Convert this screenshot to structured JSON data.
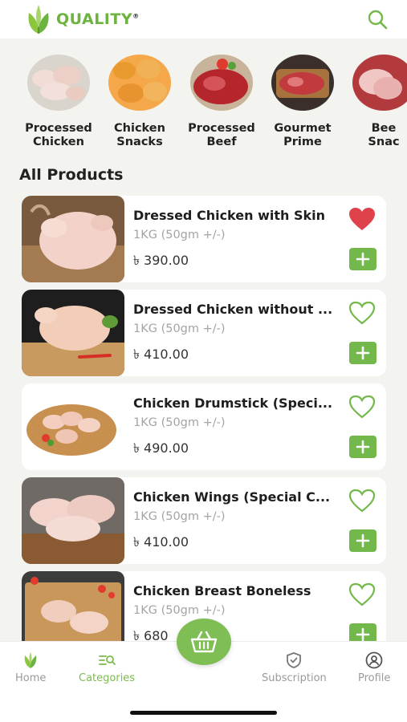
{
  "header": {
    "brand_name": "QUALITY",
    "brand_reg": "®"
  },
  "categories": [
    {
      "line1": "Processed",
      "line2": "Chicken"
    },
    {
      "line1": "Chicken",
      "line2": "Snacks"
    },
    {
      "line1": "Processed",
      "line2": "Beef"
    },
    {
      "line1": "Gourmet",
      "line2": "Prime"
    },
    {
      "line1": "Bee",
      "line2": "Snac"
    }
  ],
  "section_title": "All Products",
  "products": [
    {
      "name": "Dressed Chicken with Skin",
      "weight": "1KG (50gm +/-)",
      "price": "৳ 390.00",
      "favorite": true
    },
    {
      "name": "Dressed Chicken without ...",
      "weight": "1KG (50gm +/-)",
      "price": "৳ 410.00",
      "favorite": false
    },
    {
      "name": "Chicken Drumstick (Speci...",
      "weight": "1KG (50gm +/-)",
      "price": "৳ 490.00",
      "favorite": false
    },
    {
      "name": "Chicken Wings (Special C...",
      "weight": "1KG (50gm +/-)",
      "price": "৳ 410.00",
      "favorite": false
    },
    {
      "name": "Chicken Breast Boneless",
      "weight": "1KG (50gm +/-)",
      "price": "৳ 680",
      "favorite": false
    }
  ],
  "nav": {
    "home": "Home",
    "categories": "Categories",
    "subscription": "Subscription",
    "profile": "Profile"
  },
  "colors": {
    "accent": "#72b84a",
    "favorite": "#e0424b",
    "inactive": "#9a9a9a"
  }
}
